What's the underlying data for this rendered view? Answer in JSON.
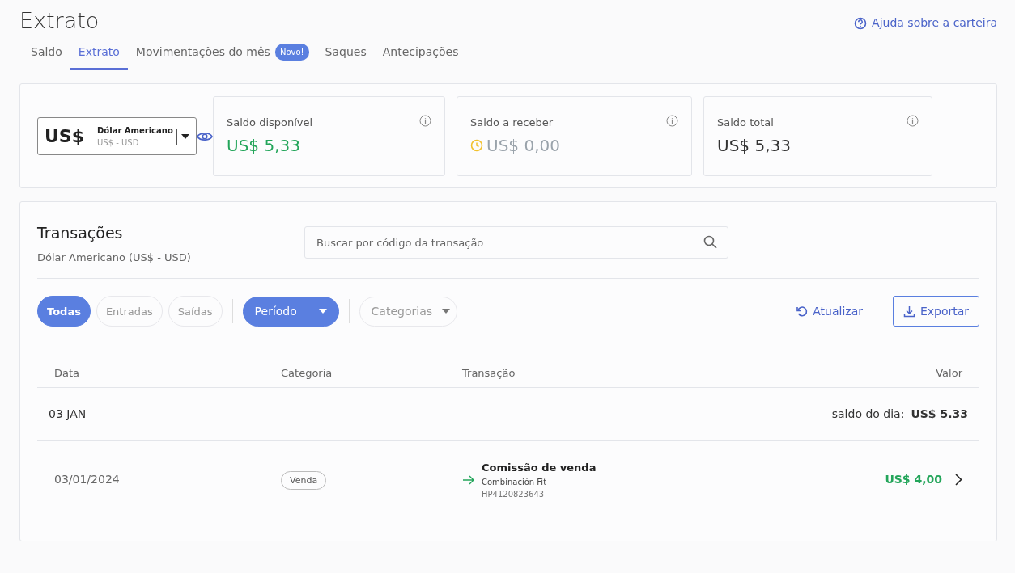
{
  "page_title": "Extrato",
  "help_link": "Ajuda sobre a carteira",
  "tabs": [
    {
      "label": "Saldo",
      "selected": false
    },
    {
      "label": "Extrato",
      "selected": true
    },
    {
      "label": "Movimentações do mês",
      "selected": false,
      "badge": "Novo!"
    },
    {
      "label": "Saques",
      "selected": false
    },
    {
      "label": "Antecipações",
      "selected": false
    }
  ],
  "currency_selector": {
    "symbol": "US$",
    "name": "Dólar Americano",
    "code": "US$ - USD"
  },
  "balance_cards": [
    {
      "kind": "available",
      "label": "Saldo disponível",
      "value": "US$ 5,33"
    },
    {
      "kind": "pending",
      "label": "Saldo a receber",
      "value": "US$ 0,00"
    },
    {
      "kind": "total",
      "label": "Saldo total",
      "value": "US$ 5,33"
    }
  ],
  "transactions": {
    "title": "Transações",
    "subtitle": "Dólar Americano (US$ - USD)",
    "search": {
      "placeholder": "Buscar por código da transação"
    },
    "filters": [
      {
        "label": "Todas",
        "selected": true
      },
      {
        "label": "Entradas",
        "selected": false
      },
      {
        "label": "Saídas",
        "selected": false
      }
    ],
    "dropdowns": [
      {
        "label": "Período",
        "selected": true
      },
      {
        "label": "Categorias",
        "selected": false
      }
    ],
    "refresh": "Atualizar",
    "export": "Exportar",
    "columns": [
      "Data",
      "Categoria",
      "Transação",
      "Valor"
    ],
    "groups": [
      {
        "day": "03 JAN",
        "balance_label": "saldo do dia:",
        "balance": "US$ 5.33",
        "rows": [
          {
            "date": "03/01/2024",
            "category": "Venda",
            "kind": "income",
            "title": "Comissão de venda",
            "product": "Combinación Fit",
            "code": "HP4120823643",
            "value": "US$ 4,00"
          }
        ]
      }
    ]
  }
}
